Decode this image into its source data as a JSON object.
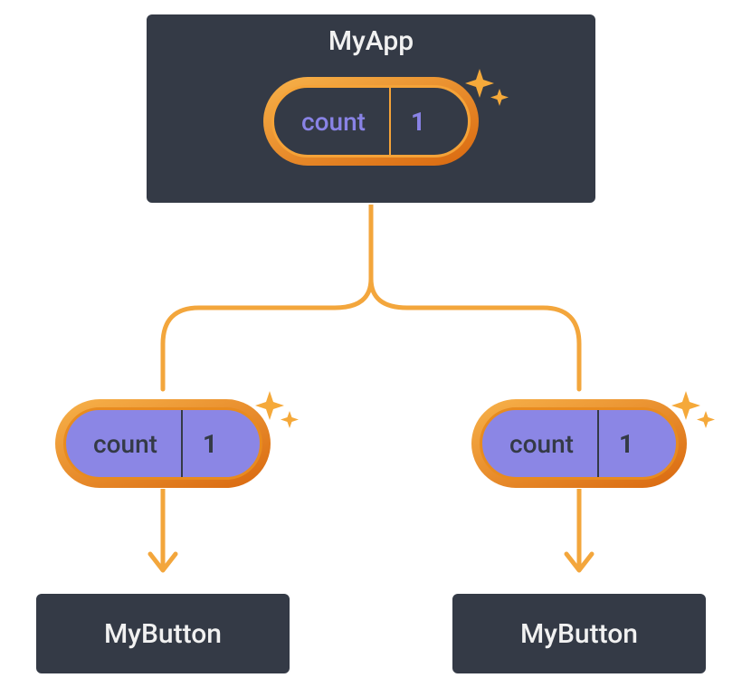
{
  "colors": {
    "box_bg": "#343a46",
    "box_border": "#fefefe",
    "accent_orange": "#f5a623",
    "accent_orange_dark": "#d9680f",
    "purple_fill": "#8b86e5",
    "text_light": "#f1f1f1",
    "text_purple": "#8983e6",
    "text_dark": "#343a46"
  },
  "root": {
    "title": "MyApp",
    "pill": {
      "label": "count",
      "value": "1",
      "variant": "dark",
      "sparkle": true
    }
  },
  "props": [
    {
      "label": "count",
      "value": "1",
      "variant": "light",
      "sparkle": true
    },
    {
      "label": "count",
      "value": "1",
      "variant": "light",
      "sparkle": true
    }
  ],
  "children": [
    {
      "title": "MyButton"
    },
    {
      "title": "MyButton"
    }
  ]
}
